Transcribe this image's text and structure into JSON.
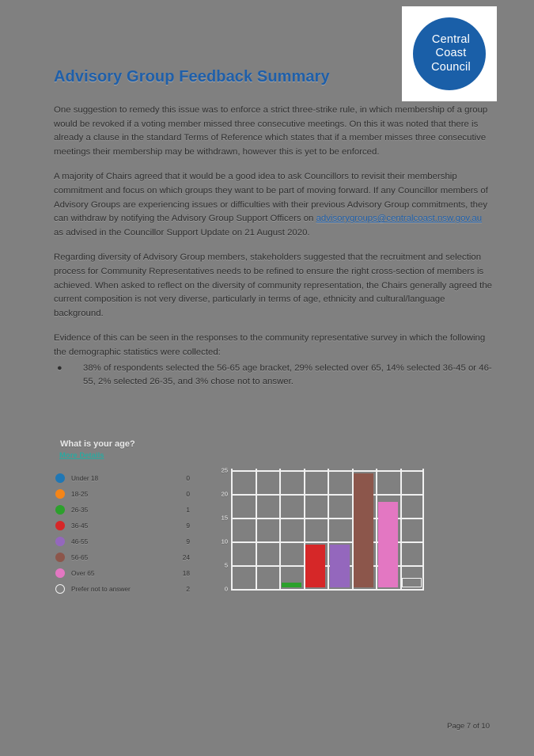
{
  "logo": {
    "lines": [
      "Central",
      "Coast",
      "Council"
    ],
    "circle_color": "#1a5fa8"
  },
  "document": {
    "title": "Advisory Group Feedback Summary",
    "title_color": "#1f5fa9",
    "footer": "Page 7 of 10"
  },
  "paragraphs": [
    "One suggestion to remedy this issue was to enforce a strict three-strike rule, in which membership of a group would be revoked if a voting member missed three consecutive meetings. On this it was noted that there is already a clause in the standard Terms of Reference which states that if a member misses three consecutive meetings their membership may be withdrawn, however this is yet to be enforced.",
    "Regarding diversity of Advisory Group members, stakeholders suggested that the recruitment and selection process for Community Representatives needs to be refined to ensure the right cross-section of members is achieved. When asked to reflect on the diversity of community representation, the Chairs generally agreed the current composition is not very diverse, particularly in terms of age, ethnicity and cultural/language background.",
    "Evidence of this can be seen in the responses to the community representative survey in which the following the demographic statistics were collected:"
  ],
  "paragraph_with_link": {
    "before": "A majority of Chairs agreed that it would be a good idea to ask Councillors to revisit their membership commitment and focus on which groups they want to be part of moving forward. If any Councillor members of Advisory Groups are experiencing issues or difficulties with their previous Advisory Group commitments, they can withdraw by notifying the Advisory Group Support Officers on ",
    "link_text": "advisorygroups@centralcoast.nsw.gov.au",
    "after": " as advised in the Councillor Support Update on 21 August 2020."
  },
  "bullets": [
    "38% of respondents selected the 56-65 age bracket, 29% selected over 65, 14% selected 36-45 or 46-55, 2% selected 26-35, and 3% chose not to answer."
  ],
  "chart_data": {
    "type": "bar",
    "title": "What is your age?",
    "subtitle": "More Details",
    "subtitle_color": "#2aa9a0",
    "xlabel": "",
    "ylabel": "",
    "ylim": [
      0,
      25
    ],
    "yticks": [
      25,
      20,
      15,
      10,
      5,
      0
    ],
    "grid": true,
    "legend_position": "left",
    "categories": [
      "Under 18",
      "18-25",
      "26-35",
      "36-45",
      "46-55",
      "56-65",
      "Over 65",
      "Prefer not to answer"
    ],
    "values": [
      0,
      0,
      1,
      9,
      9,
      24,
      18,
      2
    ],
    "colors": [
      "#2077b4",
      "#f58518",
      "#2ca02c",
      "#d62728",
      "#9467bd",
      "#8c564b",
      "#e377c2",
      "#ffffff"
    ],
    "legend_counts": [
      "0",
      "0",
      "1",
      "9",
      "9",
      "24",
      "18",
      "2"
    ]
  }
}
